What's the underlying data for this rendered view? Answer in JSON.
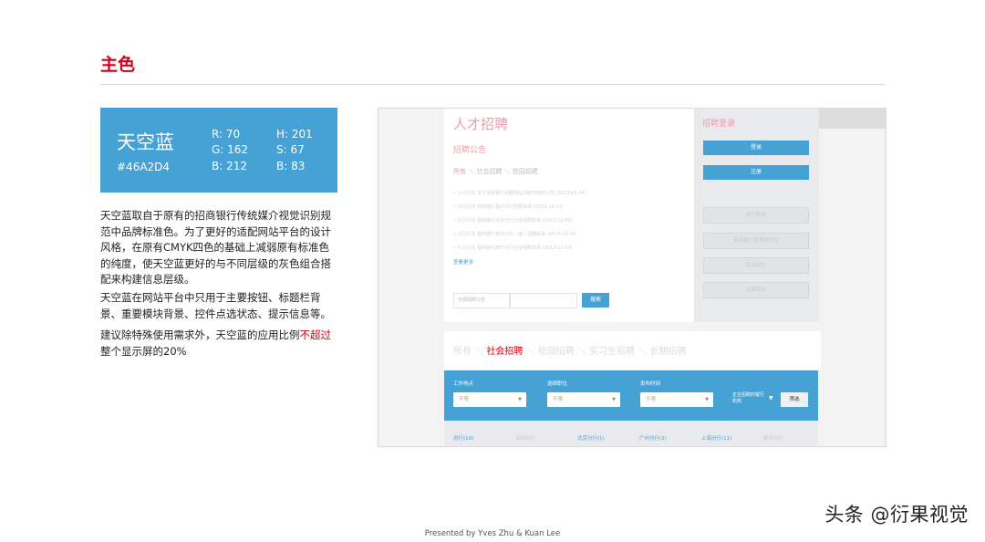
{
  "title": "主色",
  "swatch": {
    "name": "天空蓝",
    "hex": "#46A2D4",
    "r": "R: 70",
    "g": "G: 162",
    "b": "B: 212",
    "h": "H: 201",
    "s": "S: 67",
    "v": "B: 83",
    "color": "#46A2D4"
  },
  "paragraphs": {
    "p1": "天空蓝取自于原有的招商银行传统媒介视觉识别规范中品牌标准色。为了更好的适配网站平台的设计风格，在原有CMYK四色的基础上减弱原有标准色的纯度，使天空蓝更好的与不同层级的灰色组合搭配来构建信息层级。",
    "p2": "天空蓝在网站平台中只用于主要按钮、标题栏背景、重要模块背景、控件点选状态、提示信息等。",
    "p3a": "建议除特殊使用需求外，天空蓝的应用比例",
    "p3b": "不超过",
    "p3c": "整个显示屏的20%"
  },
  "shot": {
    "heading": "人才招聘",
    "subheading": "招聘公告",
    "tabs": [
      "所有",
      "社会招聘",
      "校园招聘"
    ],
    "news": [
      {
        "cat": "社会招聘",
        "text": "关于招商银行招聘网站改版升级的公告",
        "date": "(2013-05-24)"
      },
      {
        "cat": "校园招聘",
        "text": "招商银行福州分行招聘启事",
        "date": "(2013-12-13)"
      },
      {
        "cat": "校园招聘",
        "text": "招商银行北京分行社会招聘启事",
        "date": "(2013-12-06)"
      },
      {
        "cat": "校园招聘",
        "text": "招商银行安庆分行（筹）招聘启事",
        "date": "(2013-12-05)"
      },
      {
        "cat": "社会招聘",
        "text": "招商银行西宁分行社会招聘启事",
        "date": "(2013-12-03)"
      }
    ],
    "more": "查看更多",
    "search_select": "全部招聘公告",
    "search_button": "搜索",
    "login": {
      "title": "招聘登录",
      "login_btn": "登录",
      "register_btn": "注册",
      "links": [
        "部门党风",
        "招商银行管理培训生",
        "实习岗位",
        "招聘须知"
      ]
    },
    "tabs2": [
      "所有",
      "社会招聘",
      "校园招聘",
      "实习生招聘",
      "长期招聘"
    ],
    "filter": {
      "location_label": "工作地点",
      "position_label": "选择职位",
      "date_label": "发布时间",
      "placeholder": "不限",
      "org_label": "正在招聘的银行机构",
      "filter_btn": "筛选"
    },
    "branches": [
      "总行(10)",
      "深圳分行",
      "北京分行(1)",
      "广州分行(2)",
      "上海分行(11)",
      "重庆分行"
    ]
  },
  "footer": "Presented by Yves Zhu & Kuan Lee",
  "watermark": "头条 @衍果视觉"
}
